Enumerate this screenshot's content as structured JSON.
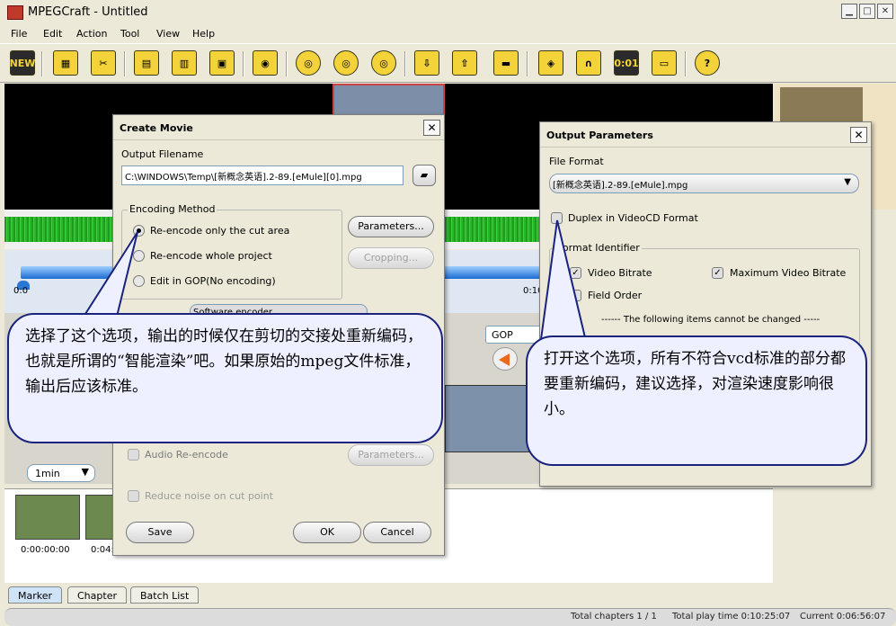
{
  "window": {
    "title": "MPEGCraft - Untitled",
    "controls": [
      "minimize-icon",
      "maximize-icon",
      "close-icon"
    ]
  },
  "menu": [
    "File",
    "Edit",
    "Action",
    "Tool",
    "View",
    "Help"
  ],
  "toolbar": {
    "new_label": "NEW",
    "timecode_label": "0:01",
    "help_label": "?"
  },
  "timeline": {
    "gop_label": "GOP",
    "zoom_label": "1min",
    "marker_left": "0:0",
    "marker_right": "0:10"
  },
  "thumbnails": [
    {
      "time": "0:00:00:00"
    },
    {
      "time": "0:04:"
    }
  ],
  "tabs": [
    "Marker",
    "Chapter",
    "Batch List"
  ],
  "status": {
    "chapters": "Total chapters 1 / 1",
    "playtime": "Total play time 0:10:25:07",
    "current": "Current 0:06:56:07"
  },
  "create_movie": {
    "title": "Create Movie",
    "output_filename_label": "Output Filename",
    "output_filename_value": "C:\\WINDOWS\\Temp\\[新概念英语].2-89.[eMule][0].mpg",
    "encoding_method_label": "Encoding Method",
    "options": [
      "Re-encode only the cut area",
      "Re-encode whole project",
      "Edit in GOP(No encoding)"
    ],
    "parameters_label": "Parameters...",
    "cropping_label": "Cropping...",
    "encoder_partial": "Software encoder",
    "audio_reencode_label": "Audio Re-encode",
    "audio_parameters_label": "Parameters...",
    "reduce_noise_label": "Reduce noise on cut point",
    "save_label": "Save",
    "ok_label": "OK",
    "cancel_label": "Cancel"
  },
  "output_params": {
    "title": "Output Parameters",
    "file_format_label": "File Format",
    "file_format_value": "[新概念英语].2-89.[eMule].mpg",
    "duplex_label": "Duplex in VideoCD Format",
    "format_identifier_label": "Format Identifier",
    "video_bitrate_label": "Video Bitrate",
    "max_video_bitrate_label": "Maximum Video Bitrate",
    "field_order_label": "Field Order",
    "cannot_change_label": "------ The following items cannot be changed -----"
  },
  "annotations": {
    "left": "选择了这个选项，输出的时候仅在剪切的交接处重新编码，也就是所谓的“智能渲染”吧。如果原始的mpeg文件标准，输出后应该标准。",
    "right": "打开这个选项，所有不符合vcd标准的部分都要重新编码，建议选择，对渲染速度影响很小。"
  },
  "colors": {
    "accent": "#1a237e",
    "bubble_fill": "#eef0ff",
    "waveform": "#2bb52b",
    "timeline_bar": "#1b6cd3"
  }
}
